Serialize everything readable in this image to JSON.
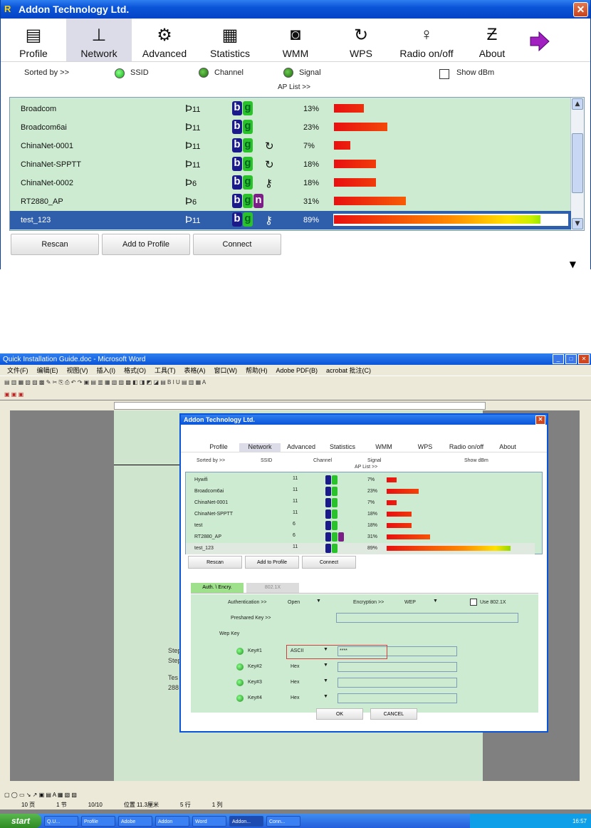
{
  "app": {
    "title": "Addon Technology Ltd.",
    "close_glyph": "✕"
  },
  "toolbar": [
    {
      "label": "Profile",
      "icon": "profile-icon"
    },
    {
      "label": "Network",
      "icon": "network-icon",
      "active": true
    },
    {
      "label": "Advanced",
      "icon": "gears-icon"
    },
    {
      "label": "Statistics",
      "icon": "statistics-icon"
    },
    {
      "label": "WMM",
      "icon": "qos-icon"
    },
    {
      "label": "WPS",
      "icon": "wps-icon"
    },
    {
      "label": "Radio on/off",
      "icon": "radio-icon"
    },
    {
      "label": "About",
      "icon": "about-icon"
    }
  ],
  "sortbar": {
    "sorted_by": "Sorted by >>",
    "ssid": "SSID",
    "channel": "Channel",
    "signal": "Signal",
    "show_dbm": "Show dBm",
    "ap_list": "AP List >>"
  },
  "ap_list": [
    {
      "ssid": "Broadcom",
      "channel": "11",
      "modes": [
        "b",
        "g"
      ],
      "security": "",
      "signal": 13
    },
    {
      "ssid": "Broadcom6ai",
      "channel": "11",
      "modes": [
        "b",
        "g"
      ],
      "security": "",
      "signal": 23
    },
    {
      "ssid": "ChinaNet-0001",
      "channel": "11",
      "modes": [
        "b",
        "g"
      ],
      "security": "wps",
      "signal": 7
    },
    {
      "ssid": "ChinaNet-SPPTT",
      "channel": "11",
      "modes": [
        "b",
        "g"
      ],
      "security": "wps",
      "signal": 18
    },
    {
      "ssid": "ChinaNet-0002",
      "channel": "6",
      "modes": [
        "b",
        "g"
      ],
      "security": "key",
      "signal": 18
    },
    {
      "ssid": "RT2880_AP",
      "channel": "6",
      "modes": [
        "b",
        "g",
        "n"
      ],
      "security": "",
      "signal": 31
    },
    {
      "ssid": "test_123",
      "channel": "11",
      "modes": [
        "b",
        "g"
      ],
      "security": "key",
      "signal": 89,
      "selected": true
    }
  ],
  "percent_suffix": "%",
  "buttons": {
    "rescan": "Rescan",
    "add_to_profile": "Add to Profile",
    "connect": "Connect"
  },
  "word": {
    "title": "Quick Installation Guide.doc - Microsoft Word",
    "menu": [
      "文件(F)",
      "编辑(E)",
      "视图(V)",
      "插入(I)",
      "格式(O)",
      "工具(T)",
      "表格(A)",
      "窗口(W)",
      "帮助(H)",
      "Adobe PDF(B)",
      "acrobat 批注(C)"
    ],
    "doc_text": [
      "Step",
      "Step",
      "Tes",
      "288"
    ],
    "status": [
      "10 页",
      "1 节",
      "10/10",
      "位置 11.3厘米",
      "5 行",
      "1 列"
    ],
    "taskbar_start": "start",
    "taskbar_items": [
      "Q.U...",
      "Profile",
      "Adobe",
      "Addon",
      "Word",
      "Addon...",
      "Conn..."
    ],
    "clock": "16:57"
  },
  "dialog": {
    "title": "Addon Technology Ltd.",
    "toolbar": [
      "Profile",
      "Network",
      "Advanced",
      "Statistics",
      "WMM",
      "WPS",
      "Radio on/off",
      "About"
    ],
    "sortbar": [
      "Sorted by >>",
      "SSID",
      "Channel",
      "Signal",
      "Show dBm",
      "AP List >>"
    ],
    "list": [
      {
        "ssid": "Hywifi",
        "ch": "11",
        "pct": "7%",
        "signal": 7
      },
      {
        "ssid": "Broadcom6ai",
        "ch": "11",
        "pct": "23%",
        "signal": 23
      },
      {
        "ssid": "ChinaNet-0001",
        "ch": "11",
        "pct": "7%",
        "signal": 7
      },
      {
        "ssid": "ChinaNet-SPPTT",
        "ch": "11",
        "pct": "18%",
        "signal": 18
      },
      {
        "ssid": "test",
        "ch": "6",
        "pct": "18%",
        "signal": 18
      },
      {
        "ssid": "RT2880_AP",
        "ch": "6",
        "pct": "31%",
        "signal": 31
      },
      {
        "ssid": "test_123",
        "ch": "11",
        "pct": "89%",
        "signal": 89
      }
    ],
    "buttons": [
      "Rescan",
      "Add to Profile",
      "Connect"
    ],
    "tabs": [
      "Auth. \\ Encry.",
      "802.1X"
    ],
    "form": {
      "authentication": "Authentication >>",
      "auth_value": "Open",
      "encryption": "Encryption >>",
      "enc_value": "WEP",
      "use_8021x": "Use 802.1X",
      "preshared": "Preshared Key >>",
      "wep_key": "Wep Key",
      "keys": [
        {
          "label": "Key#1",
          "type": "ASCII",
          "value": "****"
        },
        {
          "label": "Key#2",
          "type": "Hex",
          "value": ""
        },
        {
          "label": "Key#3",
          "type": "Hex",
          "value": ""
        },
        {
          "label": "Key#4",
          "type": "Hex",
          "value": ""
        }
      ]
    },
    "ok": "OK",
    "cancel": "CANCEL"
  }
}
